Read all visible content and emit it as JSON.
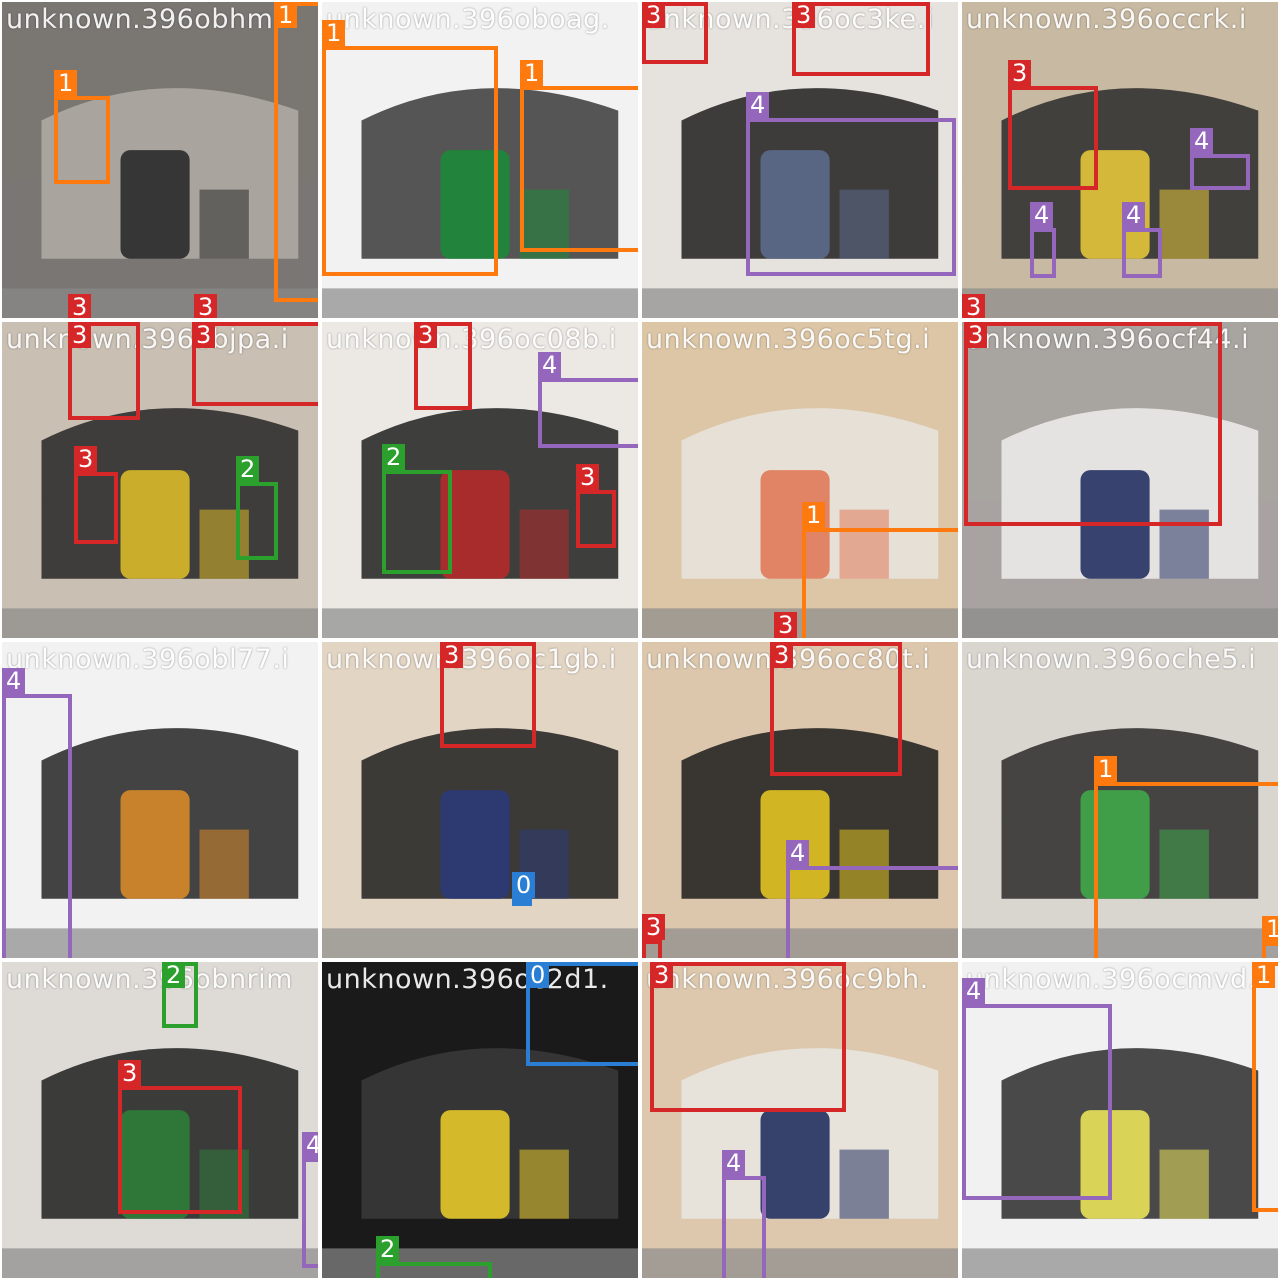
{
  "class_colors": {
    "0": "#2a7fd4",
    "1": "#ff7a0e",
    "2": "#2ca02c",
    "3": "#d62728",
    "4": "#9467bd"
  },
  "tiles": [
    {
      "filename": "unknown.396obhmn",
      "scene": [
        "#7a7773",
        "#b2ada6",
        "#2a2a2a"
      ],
      "boxes": [
        {
          "cls": "1"
        },
        {
          "cls": "1"
        },
        {
          "cls": "3"
        },
        {
          "cls": "3"
        }
      ]
    },
    {
      "filename": "unknown.396oboag.",
      "scene": [
        "#f2f2f2",
        "#3a3a3a",
        "#1d8a3a"
      ],
      "boxes": [
        {
          "cls": "1"
        },
        {
          "cls": "1"
        }
      ]
    },
    {
      "filename": "unknown.396oc3ke.i",
      "scene": [
        "#e6e3de",
        "#1f1f1f",
        "#5c6a8c"
      ],
      "boxes": [
        {
          "cls": "3"
        },
        {
          "cls": "3"
        },
        {
          "cls": "4"
        }
      ]
    },
    {
      "filename": "unknown.396occrk.i",
      "scene": [
        "#c8b9a2",
        "#2a2a2a",
        "#e3c53a"
      ],
      "boxes": [
        {
          "cls": "3"
        },
        {
          "cls": "4"
        },
        {
          "cls": "4"
        },
        {
          "cls": "4"
        },
        {
          "cls": "3"
        }
      ]
    },
    {
      "filename": "unknown.396objpa.i",
      "scene": [
        "#c9bfb3",
        "#262626",
        "#d9b92a"
      ],
      "boxes": [
        {
          "cls": "3"
        },
        {
          "cls": "3"
        },
        {
          "cls": "3"
        },
        {
          "cls": "2"
        }
      ]
    },
    {
      "filename": "unknown.396oc08b.i",
      "scene": [
        "#ece9e4",
        "#202020",
        "#b52a2a"
      ],
      "boxes": [
        {
          "cls": "3"
        },
        {
          "cls": "4"
        },
        {
          "cls": "2"
        },
        {
          "cls": "3"
        }
      ]
    },
    {
      "filename": "unknown.396oc5tg.i",
      "scene": [
        "#ddc6a6",
        "#e8e4de",
        "#e07a5a"
      ],
      "boxes": [
        {
          "cls": "1"
        },
        {
          "cls": "3"
        }
      ]
    },
    {
      "filename": "unknown.396ocf44.i",
      "scene": [
        "#a8a4a0",
        "#f0efec",
        "#243063"
      ],
      "boxes": [
        {
          "cls": "3"
        }
      ]
    },
    {
      "filename": "unknown.396obl77.i",
      "scene": [
        "#f2f2f2",
        "#242424",
        "#d88a2a"
      ],
      "boxes": [
        {
          "cls": "4"
        }
      ]
    },
    {
      "filename": "unknown.396oc1gb.i",
      "scene": [
        "#e3d5c4",
        "#1f1f1f",
        "#2b3a78"
      ],
      "boxes": [
        {
          "cls": "3"
        },
        {
          "cls": "0"
        }
      ]
    },
    {
      "filename": "unknown.396oc80t.i",
      "scene": [
        "#dcc7ad",
        "#1c1c1c",
        "#e2c321"
      ],
      "boxes": [
        {
          "cls": "3"
        },
        {
          "cls": "4"
        },
        {
          "cls": "3"
        }
      ]
    },
    {
      "filename": "unknown.396oche5.i",
      "scene": [
        "#d9d5cf",
        "#2a2a2a",
        "#3fa84a"
      ],
      "boxes": [
        {
          "cls": "1"
        },
        {
          "cls": "1"
        }
      ]
    },
    {
      "filename": "unknown.396obnrim",
      "scene": [
        "#dedbd6",
        "#1f1f1f",
        "#2f7d3a"
      ],
      "boxes": [
        {
          "cls": "2"
        },
        {
          "cls": "3"
        },
        {
          "cls": "4"
        }
      ]
    },
    {
      "filename": "unknown.396oc2d1.",
      "scene": [
        "#1a1a1a",
        "#3b3b3b",
        "#e6c829"
      ],
      "boxes": [
        {
          "cls": "0"
        },
        {
          "cls": "2"
        }
      ]
    },
    {
      "filename": "unknown.396oc9bh.",
      "scene": [
        "#ddc8ad",
        "#e9e7e3",
        "#23305f"
      ],
      "boxes": [
        {
          "cls": "3"
        },
        {
          "cls": "4"
        }
      ]
    },
    {
      "filename": "unknown.396ocmvd.",
      "scene": [
        "#f1f1f1",
        "#2b2b2b",
        "#e9e25a"
      ],
      "boxes": [
        {
          "cls": "4"
        },
        {
          "cls": "1"
        }
      ]
    }
  ]
}
